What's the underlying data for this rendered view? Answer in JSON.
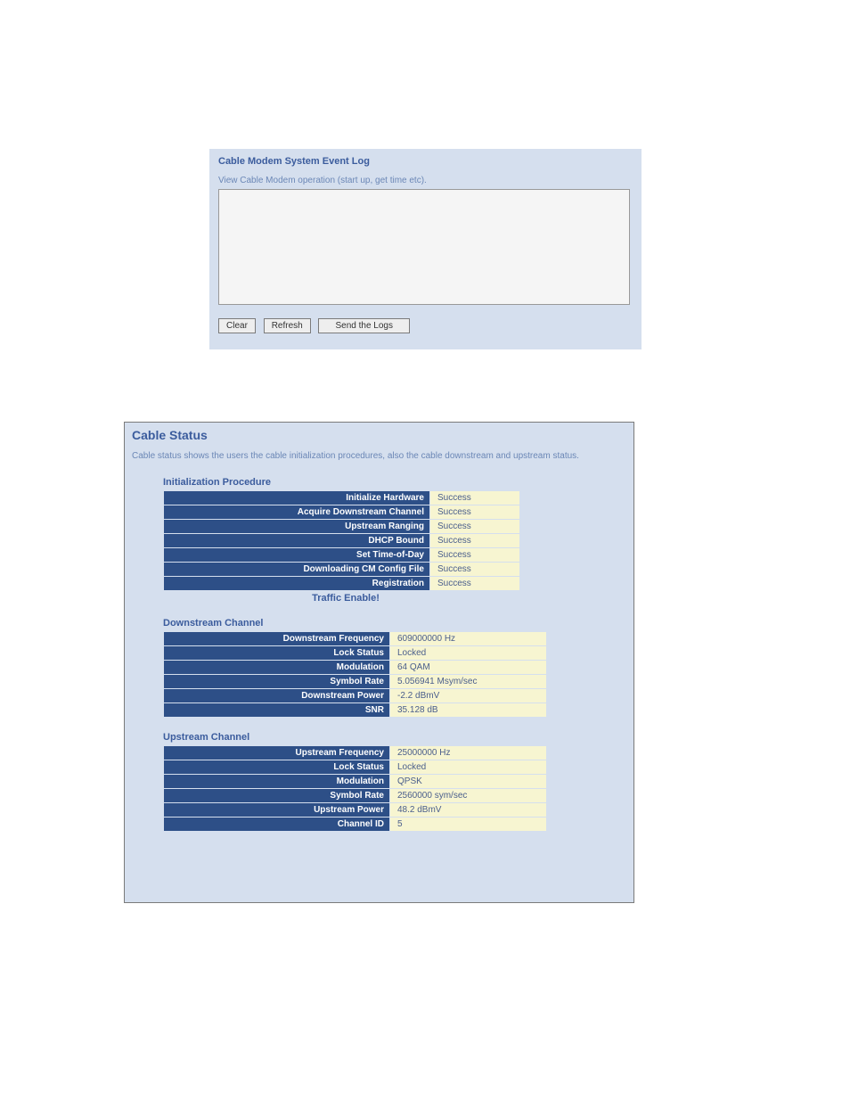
{
  "eventLog": {
    "title": "Cable Modem System Event Log",
    "description": "View Cable Modem operation (start up, get time etc).",
    "logContent": "",
    "buttons": {
      "clear": "Clear",
      "refresh": "Refresh",
      "sendLogs": "Send the Logs"
    }
  },
  "cableStatus": {
    "title": "Cable Status",
    "description": "Cable status shows the users the cable initialization procedures, also the cable downstream and upstream status.",
    "initProcedure": {
      "heading": "Initialization Procedure",
      "rows": [
        {
          "label": "Initialize Hardware",
          "value": "Success"
        },
        {
          "label": "Acquire Downstream Channel",
          "value": "Success"
        },
        {
          "label": "Upstream Ranging",
          "value": "Success"
        },
        {
          "label": "DHCP Bound",
          "value": "Success"
        },
        {
          "label": "Set Time-of-Day",
          "value": "Success"
        },
        {
          "label": "Downloading CM Config File",
          "value": "Success"
        },
        {
          "label": "Registration",
          "value": "Success"
        }
      ],
      "trafficEnable": "Traffic Enable!"
    },
    "downstream": {
      "heading": "Downstream Channel",
      "rows": [
        {
          "label": "Downstream Frequency",
          "value": "609000000 Hz"
        },
        {
          "label": "Lock Status",
          "value": "Locked"
        },
        {
          "label": "Modulation",
          "value": "64 QAM"
        },
        {
          "label": "Symbol Rate",
          "value": "5.056941 Msym/sec"
        },
        {
          "label": "Downstream Power",
          "value": "-2.2 dBmV"
        },
        {
          "label": "SNR",
          "value": "35.128 dB"
        }
      ]
    },
    "upstream": {
      "heading": "Upstream Channel",
      "rows": [
        {
          "label": "Upstream Frequency",
          "value": "25000000 Hz"
        },
        {
          "label": "Lock Status",
          "value": "Locked"
        },
        {
          "label": "Modulation",
          "value": "QPSK"
        },
        {
          "label": "Symbol Rate",
          "value": "2560000 sym/sec"
        },
        {
          "label": "Upstream Power",
          "value": "48.2 dBmV"
        },
        {
          "label": "Channel ID",
          "value": "5"
        }
      ]
    }
  }
}
